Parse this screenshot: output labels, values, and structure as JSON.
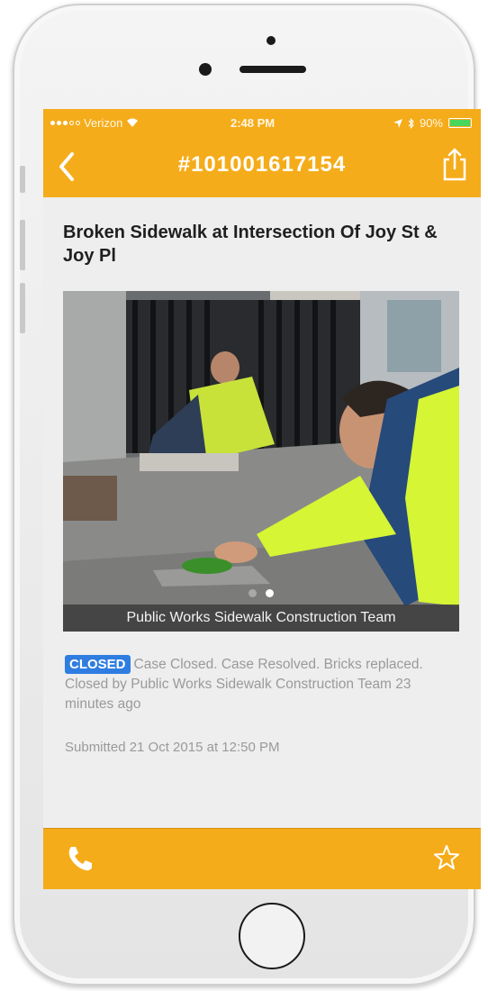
{
  "status_bar": {
    "carrier": "Verizon",
    "time": "2:48 PM",
    "battery": "90%",
    "signal_icon": "signal-dots-icon",
    "wifi_icon": "wifi-icon",
    "location_icon": "location-arrow-icon",
    "bluetooth_icon": "bluetooth-icon",
    "battery_icon": "battery-icon"
  },
  "nav": {
    "title": "#101001617154",
    "back_icon": "chevron-left-icon",
    "share_icon": "share-icon"
  },
  "case": {
    "title": "Broken Sidewalk at Intersection Of Joy St & Joy Pl",
    "photo_caption": "Public Works Sidewalk Construction Team",
    "photo_pages": 2,
    "photo_active_page": 2,
    "status_badge": "CLOSED",
    "status_text": "Case Closed. Case Resolved. Bricks replaced. Closed by Public Works Sidewalk Construction Team 23 minutes ago",
    "submitted": "Submitted 21 Oct 2015 at 12:50 PM"
  },
  "bottom_bar": {
    "phone_icon": "phone-icon",
    "star_icon": "star-icon"
  },
  "colors": {
    "accent": "#f5ac1a",
    "badge": "#2f7de1",
    "battery": "#48d65c"
  }
}
